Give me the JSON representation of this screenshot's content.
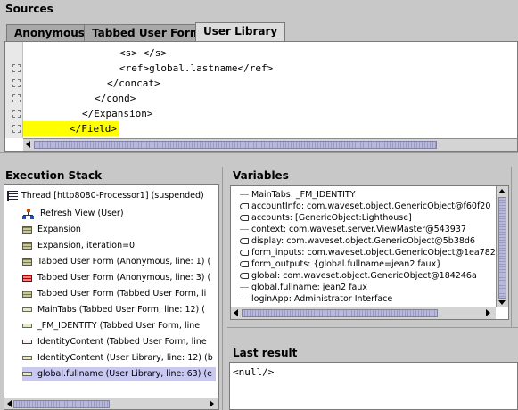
{
  "sources": {
    "title": "Sources",
    "tabs": [
      {
        "label": "Anonymous",
        "active": false
      },
      {
        "label": "Tabbed User Form",
        "active": false
      },
      {
        "label": "User Library",
        "active": true
      }
    ],
    "code_lines": [
      "<s> </s>",
      "<ref>global.lastname</ref>",
      "</concat>",
      "</cond>",
      "</Expansion>",
      "</Field>"
    ],
    "highlight_color": "#ffff00"
  },
  "execution_stack": {
    "title": "Execution Stack",
    "thread_label": "Thread [http8080-Processor1] (suspended)",
    "items": [
      {
        "label": "Refresh View (User)",
        "icon": "tree-icon"
      },
      {
        "label": "Expansion",
        "icon": "stack-frame-icon"
      },
      {
        "label": "Expansion, iteration=0",
        "icon": "stack-frame-icon"
      },
      {
        "label": "Tabbed User Form (Anonymous, line: 1) (",
        "icon": "stack-frame-icon"
      },
      {
        "label": "Tabbed User Form (Anonymous, line: 3) (",
        "icon": "red-stack-frame-icon"
      },
      {
        "label": "Tabbed User Form (Tabbed User Form, li",
        "icon": "stack-frame-icon"
      },
      {
        "label": "MainTabs (Tabbed User Form, line: 12) (",
        "icon": "frame-icon"
      },
      {
        "label": "_FM_IDENTITY (Tabbed User Form, line",
        "icon": "frame-icon"
      },
      {
        "label": "IdentityContent (Tabbed User Form, line",
        "icon": "red-frame-icon"
      },
      {
        "label": "IdentityContent (User Library, line: 12) (b",
        "icon": "frame-icon"
      },
      {
        "label": "global.fullname (User Library, line: 63) (e",
        "icon": "frame-icon"
      }
    ]
  },
  "variables": {
    "title": "Variables",
    "items": [
      {
        "label": "MainTabs: _FM_IDENTITY",
        "expandable": false
      },
      {
        "label": "accountInfo: com.waveset.object.GenericObject@f60f20",
        "expandable": true
      },
      {
        "label": "accounts: [GenericObject:Lighthouse]",
        "expandable": true
      },
      {
        "label": "context: com.waveset.server.ViewMaster@543937",
        "expandable": false
      },
      {
        "label": "display: com.waveset.object.GenericObject@5b38d6",
        "expandable": true
      },
      {
        "label": "form_inputs: com.waveset.object.GenericObject@1ea782",
        "expandable": true
      },
      {
        "label": "form_outputs: {global.fullname=jean2 faux}",
        "expandable": true
      },
      {
        "label": "global: com.waveset.object.GenericObject@184246a",
        "expandable": true
      },
      {
        "label": "global.fullname: jean2 faux",
        "expandable": false
      },
      {
        "label": "loginApp: Administrator Interface",
        "expandable": false
      }
    ]
  },
  "last_result": {
    "title": "Last result",
    "value": "<null/>"
  }
}
